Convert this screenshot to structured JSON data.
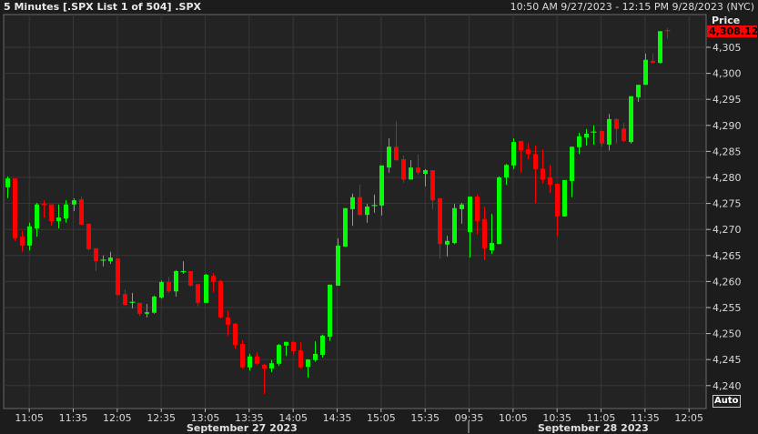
{
  "header": {
    "title": "5 Minutes [.SPX List 1 of 504] .SPX",
    "range": "10:50 AM 9/27/2023 - 12:15 PM 9/28/2023 (NYC)"
  },
  "axis": {
    "price_label": "Price",
    "last_price": "4,308.12",
    "auto_label": "Auto",
    "dates": [
      "September 27 2023",
      "September 28 2023"
    ]
  },
  "colors": {
    "up": "#00ff00",
    "down": "#ff0000",
    "last_tag": "#ff0000"
  },
  "chart_data": {
    "type": "candlestick",
    "title": "5 Minutes [.SPX List 1 of 504] .SPX",
    "ylabel": "Price",
    "ylim": [
      4236,
      4312
    ],
    "yticks": [
      4240,
      4245,
      4250,
      4255,
      4260,
      4265,
      4270,
      4275,
      4280,
      4285,
      4290,
      4295,
      4300,
      4305
    ],
    "ytick_labels": [
      "4,240",
      "4,245",
      "4,250",
      "4,255",
      "4,260",
      "4,265",
      "4,270",
      "4,275",
      "4,280",
      "4,285",
      "4,290",
      "4,295",
      "4,300",
      "4,305"
    ],
    "xticks": [
      {
        "bar": 3,
        "label": "11:05"
      },
      {
        "bar": 9,
        "label": "11:35"
      },
      {
        "bar": 15,
        "label": "12:05"
      },
      {
        "bar": 21,
        "label": "12:35"
      },
      {
        "bar": 27,
        "label": "13:05"
      },
      {
        "bar": 33,
        "label": "13:35"
      },
      {
        "bar": 39,
        "label": "14:05"
      },
      {
        "bar": 45,
        "label": "14:35"
      },
      {
        "bar": 51,
        "label": "15:05"
      },
      {
        "bar": 57,
        "label": "15:35"
      },
      {
        "bar": 63,
        "label": "09:35"
      },
      {
        "bar": 69,
        "label": "10:05"
      },
      {
        "bar": 75,
        "label": "10:35"
      },
      {
        "bar": 81,
        "label": "11:05"
      },
      {
        "bar": 87,
        "label": "11:35"
      },
      {
        "bar": 93,
        "label": "12:05"
      }
    ],
    "grid": true,
    "candles": [
      [
        4278.1,
        4280.2,
        4276.0,
        4279.8
      ],
      [
        4279.8,
        4279.8,
        4267.8,
        4268.3
      ],
      [
        4268.6,
        4269.7,
        4265.7,
        4266.9
      ],
      [
        4266.9,
        4271.3,
        4266.0,
        4270.6
      ],
      [
        4270.2,
        4275.1,
        4268.6,
        4274.8
      ],
      [
        4274.8,
        4275.6,
        4272.3,
        4274.6
      ],
      [
        4274.8,
        4274.8,
        4270.7,
        4271.6
      ],
      [
        4271.6,
        4274.8,
        4270.2,
        4272.3
      ],
      [
        4272.1,
        4275.6,
        4271.3,
        4274.8
      ],
      [
        4274.8,
        4276.0,
        4273.5,
        4275.6
      ],
      [
        4275.8,
        4276.3,
        4270.9,
        4270.9
      ],
      [
        4271.1,
        4271.1,
        4266.0,
        4266.2
      ],
      [
        4266.4,
        4266.4,
        4262.0,
        4263.9
      ],
      [
        4264.0,
        4265.0,
        4262.9,
        4264.1
      ],
      [
        4263.9,
        4265.7,
        4263.4,
        4264.6
      ],
      [
        4264.4,
        4264.4,
        4257.3,
        4257.4
      ],
      [
        4257.6,
        4258.5,
        4255.3,
        4255.5
      ],
      [
        4255.8,
        4257.8,
        4254.8,
        4256.0
      ],
      [
        4255.9,
        4255.9,
        4253.4,
        4253.8
      ],
      [
        4253.8,
        4255.7,
        4253.1,
        4254.1
      ],
      [
        4254.0,
        4257.3,
        4253.8,
        4257.1
      ],
      [
        4256.9,
        4260.2,
        4256.7,
        4259.9
      ],
      [
        4259.9,
        4260.9,
        4257.8,
        4258.1
      ],
      [
        4258.1,
        4262.2,
        4257.1,
        4262.0
      ],
      [
        4261.7,
        4263.9,
        4261.5,
        4261.9
      ],
      [
        4262.0,
        4262.0,
        4259.0,
        4259.2
      ],
      [
        4259.5,
        4259.5,
        4255.2,
        4255.9
      ],
      [
        4255.9,
        4261.5,
        4255.9,
        4261.3
      ],
      [
        4261.1,
        4261.6,
        4258.0,
        4259.9
      ],
      [
        4260.1,
        4260.3,
        4252.9,
        4253.1
      ],
      [
        4253.1,
        4254.5,
        4249.6,
        4251.7
      ],
      [
        4251.9,
        4252.0,
        4247.1,
        4247.8
      ],
      [
        4248.0,
        4248.7,
        4243.3,
        4243.5
      ],
      [
        4243.5,
        4246.1,
        4242.9,
        4245.6
      ],
      [
        4245.6,
        4246.4,
        4244.0,
        4244.2
      ],
      [
        4244.0,
        4244.2,
        4238.4,
        4243.3
      ],
      [
        4243.3,
        4244.9,
        4242.6,
        4244.3
      ],
      [
        4244.2,
        4248.0,
        4243.8,
        4247.8
      ],
      [
        4247.7,
        4248.4,
        4245.7,
        4248.4
      ],
      [
        4248.4,
        4248.5,
        4246.1,
        4246.6
      ],
      [
        4246.8,
        4248.4,
        4243.3,
        4243.5
      ],
      [
        4243.6,
        4245.1,
        4241.5,
        4245.0
      ],
      [
        4244.9,
        4248.5,
        4244.6,
        4246.1
      ],
      [
        4245.9,
        4249.8,
        4245.4,
        4249.6
      ],
      [
        4249.4,
        4259.4,
        4248.6,
        4259.4
      ],
      [
        4259.2,
        4268.3,
        4259.2,
        4266.9
      ],
      [
        4266.7,
        4274.1,
        4266.7,
        4274.1
      ],
      [
        4273.9,
        4276.9,
        4270.7,
        4276.2
      ],
      [
        4276.2,
        4278.6,
        4272.6,
        4272.8
      ],
      [
        4272.8,
        4274.9,
        4271.3,
        4274.4
      ],
      [
        4274.4,
        4276.7,
        4273.2,
        4274.6
      ],
      [
        4274.6,
        4282.3,
        4272.7,
        4282.3
      ],
      [
        4281.9,
        4287.5,
        4280.9,
        4285.9
      ],
      [
        4285.9,
        4290.8,
        4283.2,
        4283.3
      ],
      [
        4283.5,
        4284.2,
        4278.9,
        4279.6
      ],
      [
        4279.6,
        4283.3,
        4279.6,
        4281.9
      ],
      [
        4281.9,
        4284.4,
        4280.5,
        4280.9
      ],
      [
        4280.7,
        4281.6,
        4278.3,
        4281.4
      ],
      [
        4281.4,
        4281.4,
        4273.9,
        4275.6
      ],
      [
        4276.0,
        4276.0,
        4264.4,
        4267.2
      ],
      [
        4267.1,
        4268.8,
        4264.8,
        4267.8
      ],
      [
        4267.4,
        4274.9,
        4267.2,
        4274.1
      ],
      [
        4273.9,
        4275.1,
        4271.1,
        4274.8
      ],
      [
        4269.5,
        4276.3,
        4264.6,
        4276.3
      ],
      [
        4276.3,
        4276.7,
        4269.0,
        4271.6
      ],
      [
        4272.0,
        4274.4,
        4264.1,
        4266.4
      ],
      [
        4266.0,
        4273.0,
        4265.3,
        4267.4
      ],
      [
        4267.2,
        4280.2,
        4267.2,
        4280.0
      ],
      [
        4280.0,
        4282.6,
        4278.6,
        4282.4
      ],
      [
        4282.3,
        4287.5,
        4281.6,
        4286.8
      ],
      [
        4287.0,
        4287.0,
        4280.9,
        4285.2
      ],
      [
        4285.4,
        4286.6,
        4283.5,
        4284.5
      ],
      [
        4284.5,
        4286.1,
        4275.1,
        4281.6
      ],
      [
        4281.7,
        4285.4,
        4278.8,
        4279.6
      ],
      [
        4280.0,
        4282.4,
        4277.0,
        4278.6
      ],
      [
        4278.8,
        4278.8,
        4268.8,
        4272.5
      ],
      [
        4272.5,
        4279.5,
        4272.5,
        4279.5
      ],
      [
        4279.3,
        4285.9,
        4276.2,
        4285.9
      ],
      [
        4285.8,
        4288.6,
        4284.5,
        4287.9
      ],
      [
        4287.7,
        4289.3,
        4286.1,
        4288.4
      ],
      [
        4288.5,
        4290.0,
        4286.3,
        4288.7
      ],
      [
        4288.9,
        4289.0,
        4285.9,
        4286.5
      ],
      [
        4286.3,
        4292.2,
        4285.2,
        4291.2
      ],
      [
        4291.2,
        4291.4,
        4286.5,
        4289.3
      ],
      [
        4289.4,
        4290.5,
        4286.8,
        4287.0
      ],
      [
        4286.8,
        4295.6,
        4286.5,
        4295.6
      ],
      [
        4295.4,
        4297.8,
        4294.5,
        4297.8
      ],
      [
        4297.8,
        4303.8,
        4297.8,
        4302.6
      ],
      [
        4302.4,
        4303.8,
        4302.0,
        4302.0
      ],
      [
        4302.0,
        4308.1,
        4301.9,
        4308.1
      ],
      [
        4308.2,
        4308.7,
        4306.7,
        4308.12
      ]
    ]
  }
}
